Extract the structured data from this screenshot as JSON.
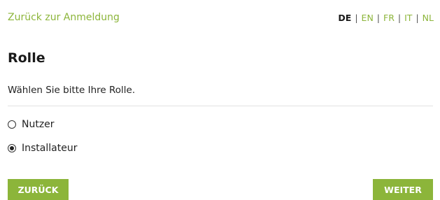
{
  "header": {
    "back_link": "Zurück zur Anmeldung",
    "languages": [
      {
        "code": "DE",
        "active": true
      },
      {
        "code": "EN",
        "active": false
      },
      {
        "code": "FR",
        "active": false
      },
      {
        "code": "IT",
        "active": false
      },
      {
        "code": "NL",
        "active": false
      }
    ],
    "separator": "|"
  },
  "main": {
    "title": "Rolle",
    "subtitle": "Wählen Sie bitte Ihre Rolle.",
    "options": [
      {
        "label": "Nutzer",
        "checked": false
      },
      {
        "label": "Installateur",
        "checked": true
      }
    ]
  },
  "buttons": {
    "back_label": "ZURÜCK",
    "next_label": "WEITER"
  },
  "colors": {
    "accent": "#8cb53a",
    "text": "#222222",
    "divider": "#e2e2e2"
  }
}
